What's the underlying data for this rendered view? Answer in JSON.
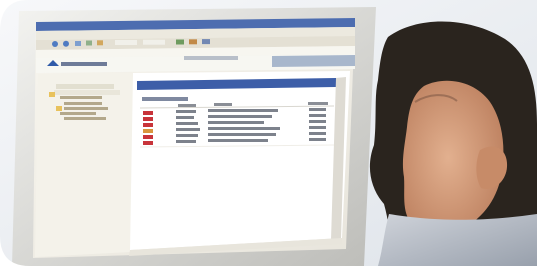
{
  "scene": {
    "description_visible": false,
    "colors": {
      "background": "#ffffff",
      "monitor_bezel": "#d8d8d6",
      "screen_bg": "#f3f1ea",
      "titlebar": "#4d6db0",
      "panel_bg": "#f7f6ef",
      "content_bg": "#ffffff",
      "header_blue": "#3d5ea8",
      "row_red": "#c8343a",
      "row_orange": "#d9963d",
      "hair": "#2a241e",
      "skin": "#d6a27f",
      "wall": "#e8ebef"
    }
  }
}
